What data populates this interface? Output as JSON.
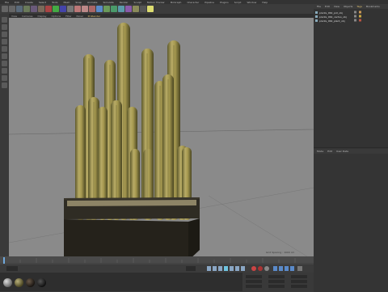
{
  "menubar": {
    "items": [
      "File",
      "Edit",
      "Create",
      "Select",
      "Tools",
      "Mesh",
      "Snap",
      "Animate",
      "Simulate",
      "Render",
      "Sculpt",
      "Motion Tracker",
      "MoGraph",
      "Character",
      "Pipeline",
      "Plugins",
      "Script",
      "Window",
      "Help"
    ]
  },
  "viewport_menu": {
    "items": [
      "View",
      "Cameras",
      "Display",
      "Options",
      "Filter",
      "Panel",
      "ProRender"
    ]
  },
  "viewport_status": "Grid Spacing : 1000 cm",
  "object_manager": {
    "tabs": [
      "File",
      "Edit",
      "View",
      "Objects",
      "Tags",
      "Bookmarks"
    ],
    "objects": [
      {
        "name": "plants_064_pot_obj"
      },
      {
        "name": "plants_064_cactus_obj"
      },
      {
        "name": "plants_064_plant_obj"
      }
    ]
  },
  "attribute_manager": {
    "tabs": [
      "Mode",
      "Edit",
      "User Data"
    ]
  },
  "colors": {
    "viewport_bg": "#8a8a8a",
    "pot": "#27241d",
    "cactus": "#a89a55",
    "accent": "#d4a020"
  }
}
